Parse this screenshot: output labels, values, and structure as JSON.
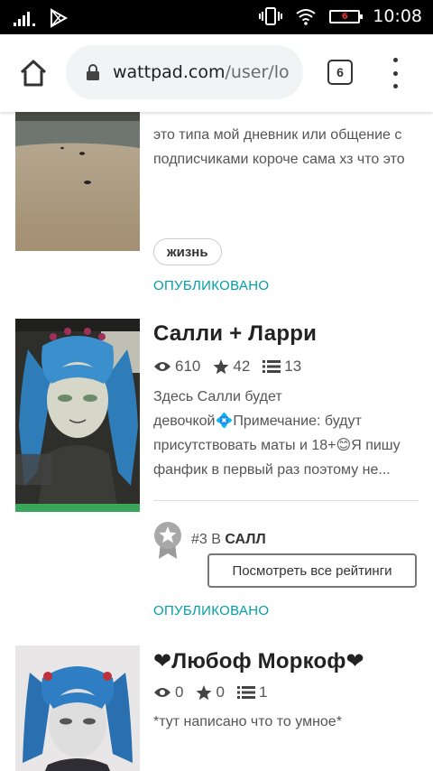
{
  "status_bar": {
    "time": "10:08",
    "battery_level": "6"
  },
  "browser": {
    "url_domain": "wattpad.com",
    "url_path": "/user/lo",
    "tab_count": "6"
  },
  "stories": [
    {
      "description": "это типа мой дневник или общение с подписчиками короче сама хз что это",
      "tag": "жизнь",
      "status": "ОПУБЛИКОВАНО"
    },
    {
      "title": "Салли + Ларри",
      "views": "610",
      "votes": "42",
      "parts": "13",
      "description": "Здесь Салли будет девочкой💠Примечание: будут присутствовать маты и 18+😊Я пишу фанфик в первый раз поэтому не...",
      "rank_number": "#3",
      "rank_in": "В",
      "rank_category": "САЛЛ",
      "ratings_button": "Посмотреть все рейтинги",
      "status": "ОПУБЛИКОВАНО"
    },
    {
      "title": "❤Любоф Моркоф❤",
      "views": "0",
      "votes": "0",
      "parts": "1",
      "description": "*тут написано что то умное*"
    }
  ],
  "colors": {
    "accent": "#00a0a6",
    "status_bar": "#000000",
    "url_box": "#f1f3f4"
  }
}
